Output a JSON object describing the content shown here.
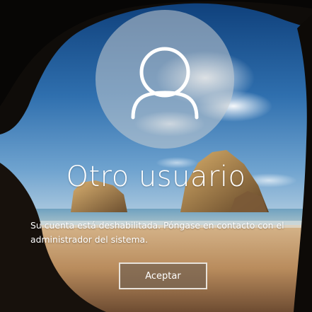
{
  "lock_screen": {
    "avatar_icon": "user-silhouette-icon",
    "username": "Otro usuario",
    "message": "Su cuenta está deshabilitada. Póngase en contacto con el administrador del sistema.",
    "accept_button_label": "Aceptar"
  },
  "colors": {
    "text": "#ffffff",
    "button_border": "#e8e2da",
    "button_fill": "#78644f"
  }
}
